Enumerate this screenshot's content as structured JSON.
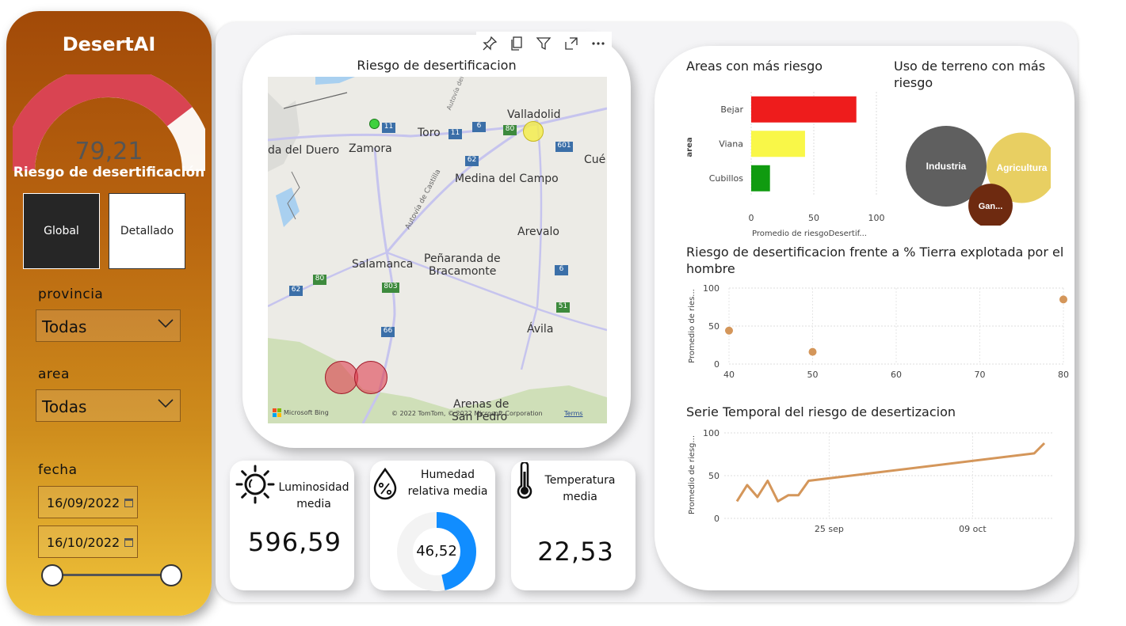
{
  "app": {
    "title": "DesertAI"
  },
  "gauge": {
    "value": "79,21",
    "value_num": 79.21,
    "max": 100,
    "label": "Riesgo de desertificación",
    "fill_color": "#d94452"
  },
  "mode_buttons": {
    "global": "Global",
    "detallado": "Detallado",
    "selected": "global"
  },
  "filters": {
    "provincia": {
      "label": "provincia",
      "value": "Todas"
    },
    "area": {
      "label": "area",
      "value": "Todas"
    },
    "fecha": {
      "label": "fecha",
      "start": "16/09/2022",
      "end": "16/10/2022"
    }
  },
  "map": {
    "title": "Riesgo de desertificacion",
    "places": [
      "Valladolid",
      "Zamora",
      "Toro",
      "da del Duero",
      "Cué",
      "Medina del Campo",
      "Arevalo",
      "Salamanca",
      "Peñaranda de",
      "Bracamonte",
      "Ávila",
      "Arenas de",
      "San Pedro"
    ],
    "road_labels": [
      "11",
      "6",
      "80",
      "11",
      "601",
      "62",
      "80",
      "62",
      "803",
      "6",
      "51",
      "66"
    ],
    "road_texts": [
      "Autovía de Castilla",
      "Autovía del Noroeste"
    ],
    "attribution": "© 2022 TomTom, © 2022 Microsoft Corporation",
    "terms": "Terms",
    "brand": "Microsoft Bing"
  },
  "kpis": {
    "luminosidad": {
      "label_1": "Luminosidad",
      "label_2": "media",
      "value": "596,59"
    },
    "humedad": {
      "label_1": "Humedad",
      "label_2": "relativa media",
      "value": "46,52",
      "percent": 46.52
    },
    "temperatura": {
      "label_1": "Temperatura",
      "label_2": "media",
      "value": "22,53"
    }
  },
  "colors": {
    "accent_orange": "#d4965a",
    "high": "#ee1c1c",
    "medium": "#f9f748",
    "low": "#109b10",
    "donut": "#118dff"
  },
  "icons": [
    "pin-icon",
    "copy-icon",
    "filter-icon",
    "expand-icon",
    "more-icon",
    "sun-icon",
    "humidity-icon",
    "thermometer-icon",
    "calendar-icon",
    "chevron-down-icon"
  ],
  "chart_data": [
    {
      "type": "bar",
      "orientation": "horizontal",
      "title": "Areas con más riesgo",
      "xlabel": "Promedio de riesgoDesertif...",
      "ylabel": "area",
      "categories": [
        "Bejar",
        "Viana",
        "Cubillos"
      ],
      "values": [
        84,
        43,
        15
      ],
      "colors": [
        "#ee1c1c",
        "#f9f748",
        "#109b10"
      ],
      "xlim": [
        0,
        100
      ],
      "xticks": [
        0,
        50,
        100
      ],
      "grid": true
    },
    {
      "type": "bubble",
      "title": "Uso de terreno con más riesgo",
      "categories": [
        "Industria",
        "Agricultura",
        "Gan..."
      ],
      "values": [
        100,
        76,
        30
      ],
      "colors": [
        "#5f5f5f",
        "#e8cf62",
        "#6e2a10"
      ]
    },
    {
      "type": "scatter",
      "title": "Riesgo de desertificacion frente a % Tierra explotada por el hombre",
      "ylabel": "Promedio de ries...",
      "x": [
        40,
        50,
        80
      ],
      "y": [
        44,
        16,
        85
      ],
      "xlim": [
        40,
        80
      ],
      "ylim": [
        0,
        100
      ],
      "xticks": [
        40,
        50,
        60,
        70,
        80
      ],
      "yticks": [
        0,
        50,
        100
      ],
      "color": "#d4965a",
      "grid": true
    },
    {
      "type": "line",
      "title": "Serie Temporal del riesgo de desertizacion",
      "ylabel": "Promedio de riesg...",
      "x": [
        "2022-09-16",
        "2022-09-17",
        "2022-09-18",
        "2022-09-19",
        "2022-09-20",
        "2022-09-21",
        "2022-09-22",
        "2022-09-23",
        "2022-10-15",
        "2022-10-16"
      ],
      "y": [
        20,
        39,
        25,
        44,
        20,
        27,
        27,
        44,
        76,
        88
      ],
      "xticks": [
        "25 sep",
        "09 oct"
      ],
      "xtick_dates": [
        "2022-09-25",
        "2022-10-09"
      ],
      "ylim": [
        0,
        100
      ],
      "yticks": [
        0,
        50,
        100
      ],
      "color": "#d4965a",
      "grid": true
    }
  ]
}
